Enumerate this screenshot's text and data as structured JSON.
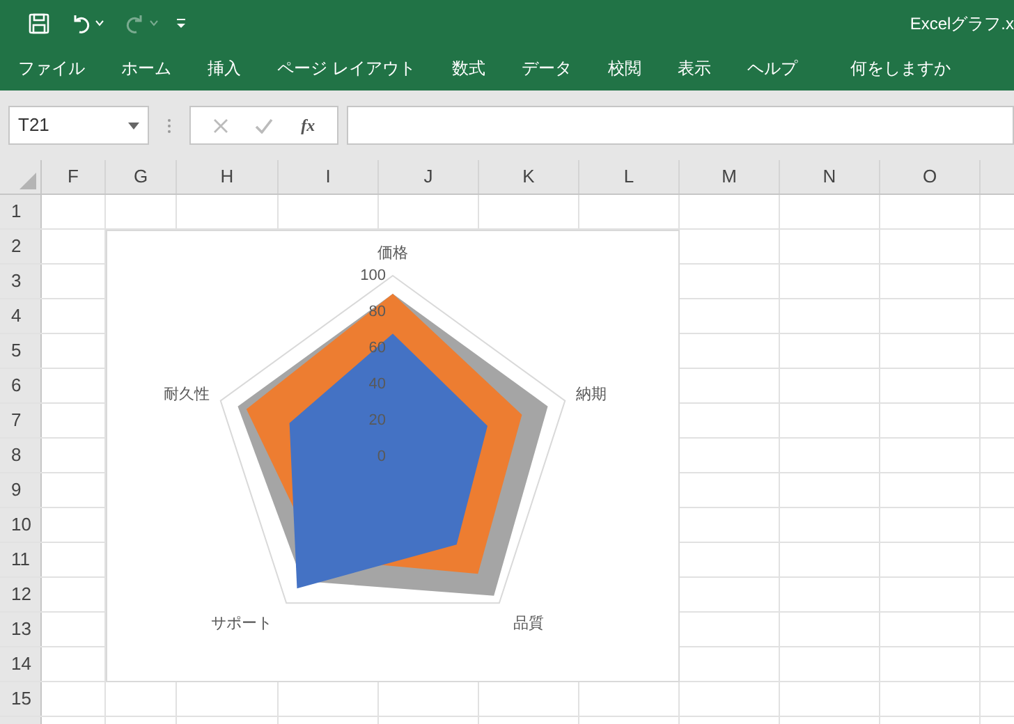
{
  "window": {
    "title": "Excelグラフ.x"
  },
  "quick_access": {
    "redo_disabled": true
  },
  "ribbon_tabs": [
    {
      "label": "ファイル"
    },
    {
      "label": "ホーム"
    },
    {
      "label": "挿入"
    },
    {
      "label": "ページ レイアウト"
    },
    {
      "label": "数式"
    },
    {
      "label": "データ"
    },
    {
      "label": "校閲"
    },
    {
      "label": "表示"
    },
    {
      "label": "ヘルプ"
    }
  ],
  "tell_me": {
    "placeholder": "何をしますか"
  },
  "formula_bar": {
    "name_box": "T21",
    "function_label": "fx"
  },
  "sheet": {
    "columns": [
      "F",
      "G",
      "H",
      "I",
      "J",
      "K",
      "L",
      "M",
      "N",
      "O"
    ],
    "rows": [
      "1",
      "2",
      "3",
      "4",
      "5",
      "6",
      "7",
      "8",
      "9",
      "10",
      "11",
      "12",
      "13",
      "14",
      "15"
    ],
    "chart": {
      "chart_data": {
        "type": "radar",
        "categories": [
          "価格",
          "納期",
          "品質",
          "サポート",
          "耐久性"
        ],
        "ylim": [
          0,
          100
        ],
        "yticks": [
          {
            "value": 0,
            "label": "0"
          },
          {
            "value": 20,
            "label": "20"
          },
          {
            "value": 40,
            "label": "40"
          },
          {
            "value": 60,
            "label": "60"
          },
          {
            "value": 80,
            "label": "80"
          },
          {
            "value": 100,
            "label": "100"
          }
        ],
        "series": [
          {
            "color": "#a5a5a5",
            "values": [
              90,
              90,
              95,
              85,
              90
            ]
          },
          {
            "color": "#ed7d31",
            "values": [
              90,
              75,
              80,
              70,
              85
            ]
          },
          {
            "color": "#4472c4",
            "values": [
              68,
              55,
              60,
              90,
              60
            ]
          }
        ]
      }
    }
  }
}
